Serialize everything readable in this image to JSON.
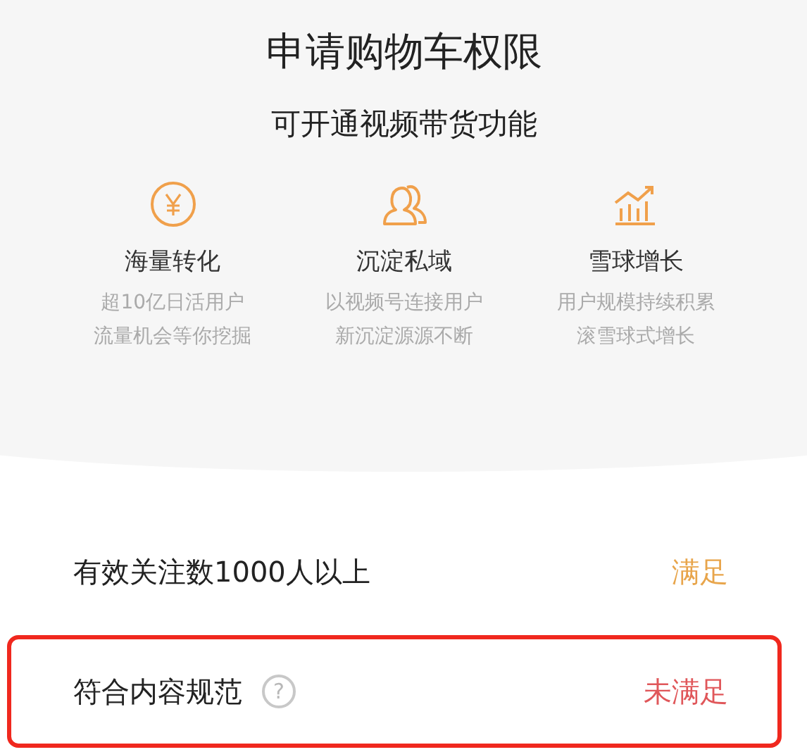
{
  "header": {
    "title": "申请购物车权限",
    "subtitle": "可开通视频带货功能"
  },
  "features": [
    {
      "kind": "yen",
      "title": "海量转化",
      "lines": [
        "超10亿日活用户",
        "流量机会等你挖掘"
      ]
    },
    {
      "kind": "people",
      "title": "沉淀私域",
      "lines": [
        "以视频号连接用户",
        "新沉淀源源不断"
      ]
    },
    {
      "kind": "chart",
      "title": "雪球增长",
      "lines": [
        "用户规模持续积累",
        "滚雪球式增长"
      ]
    }
  ],
  "requirements": [
    {
      "label": "有效关注数1000人以上",
      "status": "满足",
      "kind": "met",
      "highlighted": false
    },
    {
      "label": "符合内容规范",
      "help": "?",
      "status": "未满足",
      "kind": "unmet",
      "highlighted": true
    }
  ]
}
